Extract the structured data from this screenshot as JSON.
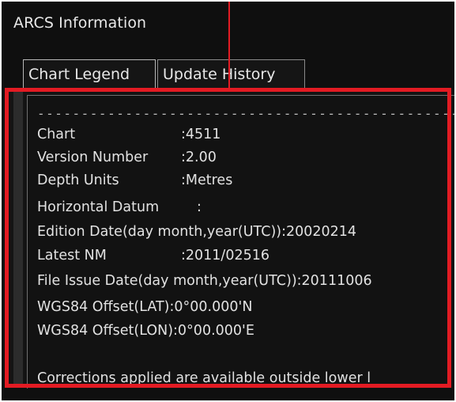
{
  "window": {
    "title": "ARCS Information"
  },
  "tabs": [
    {
      "label": "Chart Legend",
      "active": true
    },
    {
      "label": "Update History",
      "active": false
    }
  ],
  "legend": {
    "separator": "------------------------------------------------",
    "rows": [
      {
        "label": "Chart",
        "value": ":4511"
      },
      {
        "label": "Version Number",
        "value": ":2.00"
      },
      {
        "label": "Depth Units",
        "value": ":Metres"
      },
      {
        "label": "Horizontal Datum",
        "value": ":"
      },
      {
        "label": "Edition Date(day month,year(UTC)):20020214",
        "value": ""
      },
      {
        "label": "Latest NM",
        "value": ":2011/02516"
      },
      {
        "label": "File Issue Date(day month,year(UTC)):20111006",
        "value": ""
      },
      {
        "label": "WGS84 Offset(LAT):0°00.000'N",
        "value": ""
      },
      {
        "label": "WGS84 Offset(LON):0°00.000'E",
        "value": ""
      }
    ],
    "corrections_note": "Corrections applied are available outside lower l"
  },
  "colors": {
    "highlight": "#e31b23",
    "background": "#0f0f0f",
    "text": "#e2e2e2"
  }
}
